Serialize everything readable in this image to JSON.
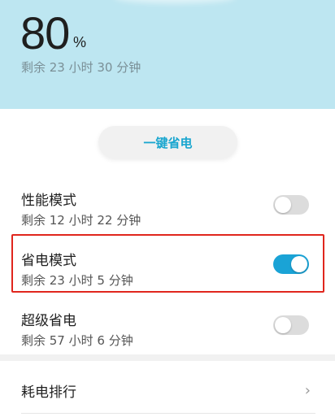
{
  "battery": {
    "percent": "80",
    "unit": "%",
    "remaining": "剩余 23 小时 30 分钟"
  },
  "one_key": {
    "label": "一键省电"
  },
  "modes": [
    {
      "title": "性能模式",
      "remaining": "剩余 12 小时 22 分钟",
      "enabled": false
    },
    {
      "title": "省电模式",
      "remaining": "剩余 23 小时 5 分钟",
      "enabled": true
    },
    {
      "title": "超级省电",
      "remaining": "剩余 57 小时 6 分钟",
      "enabled": false
    }
  ],
  "ranking": {
    "label": "耗电排行",
    "chevron": "›"
  },
  "colors": {
    "header_bg": "#bde6f1",
    "accent": "#1aa6cf",
    "toggle_on": "#1aa3d6",
    "highlight": "#e0261d"
  }
}
